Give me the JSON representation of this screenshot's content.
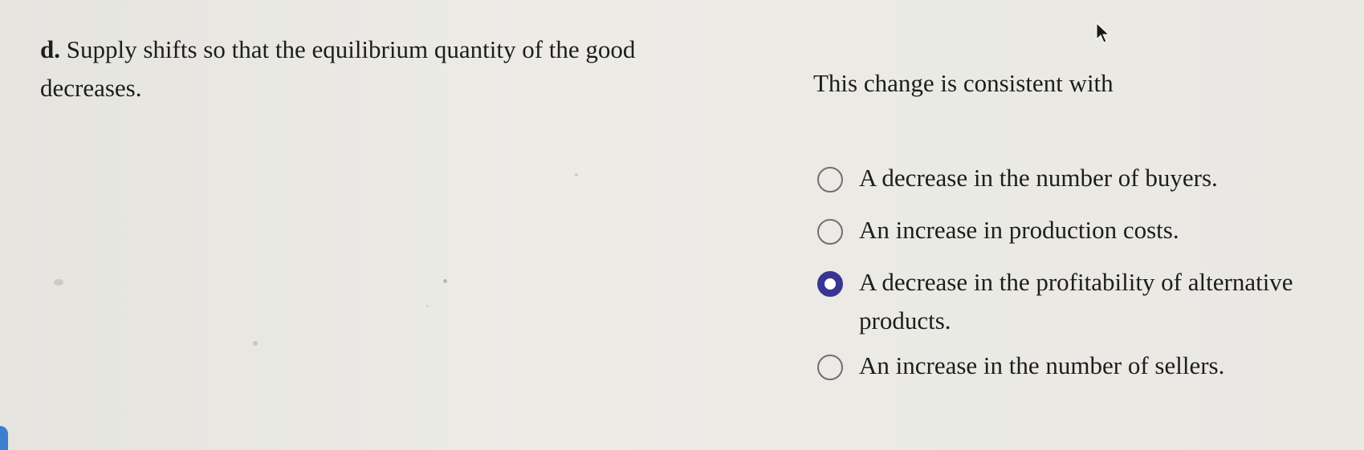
{
  "question": {
    "part_letter": "d.",
    "text_line1": "Supply shifts so that the equilibrium quantity of the good",
    "text_line2": "decreases."
  },
  "prompt": "This change is consistent with",
  "options": [
    {
      "label": "A decrease in the number of buyers.",
      "selected": false
    },
    {
      "label": "An increase in production costs.",
      "selected": false
    },
    {
      "label": "A decrease in the profitability of alternative products.",
      "selected": true
    },
    {
      "label": "An increase in the number of sellers.",
      "selected": false
    }
  ],
  "colors": {
    "selected_radio": "#3a3590",
    "unselected_radio_border": "#6f6f74",
    "background": "#e9e8e3",
    "text": "#1d1d1f"
  }
}
